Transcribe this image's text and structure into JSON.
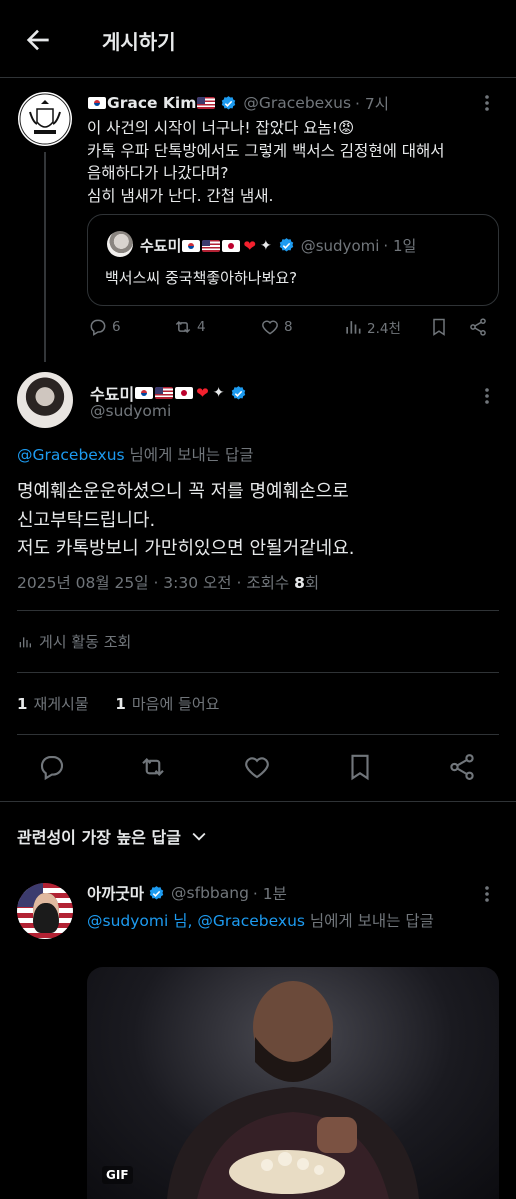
{
  "header": {
    "title": "게시하기"
  },
  "parent_tweet": {
    "name": "Grace Kim",
    "handle": "@Gracebexus",
    "time": "· 7시",
    "lines": [
      "이 사건의 시작이 너구나! 잡았다 요놈!😡",
      "카톡 우파 단톡방에서도 그렇게 백서스 김정현에 대해서",
      "음해하다가 나갔다며?",
      "심히 냄새가 난다. 간첩 냄새."
    ],
    "quote": {
      "name": "수됴미",
      "handle": "@sudyomi",
      "time": "· 1일",
      "text": "백서스씨 중국책좋아하나봐요?"
    },
    "replies": "6",
    "reposts": "4",
    "likes": "8",
    "views": "2.4천"
  },
  "main_tweet": {
    "name": "수됴미",
    "handle": "@sudyomi",
    "reply_to_handle": "@Gracebexus",
    "reply_to_suffix": " 님에게 보내는 답글",
    "lines": [
      "명예훼손운운하셨으니 꼭 저를 명예훼손으로",
      "신고부탁드립니다.",
      "저도 카톡방보니 가만히있으면 안될거같네요."
    ],
    "meta_prefix": "2025년 08월 25일 · 3:30 오전 · 조회수 ",
    "views": "8",
    "meta_suffix": "회",
    "activity": "게시 활동 조회",
    "reposts_count": "1",
    "reposts_label": "재게시물",
    "likes_count": "1",
    "likes_label": "마음에 들어요"
  },
  "sort": {
    "label": "관련성이 가장 높은 답글"
  },
  "reply": {
    "name": "아까굿마",
    "handle": "@sfbbang",
    "time": "· 1분",
    "to_1": "@sudyomi",
    "to_mid": " 님, ",
    "to_2": "@Gracebexus",
    "to_suffix": " 님에게 보내는 답글",
    "gif_label": "GIF"
  },
  "colors": {
    "accent": "#1d9bf0",
    "muted": "#71767b",
    "background": "#000000",
    "border": "#2f3336"
  }
}
